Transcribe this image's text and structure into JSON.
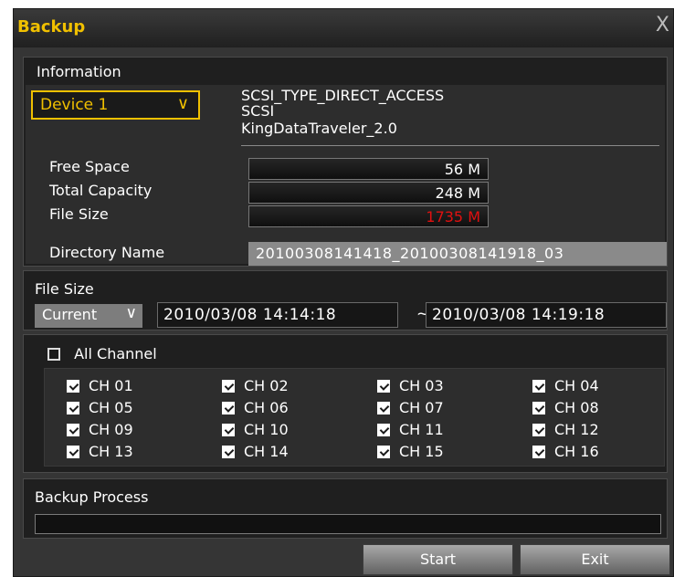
{
  "window": {
    "title": "Backup",
    "close_glyph": "X"
  },
  "information": {
    "label": "Information",
    "device": "Device 1",
    "device_lines": [
      "SCSI_TYPE_DIRECT_ACCESS",
      "SCSI",
      "KingDataTraveler_2.0"
    ],
    "rows": [
      {
        "label": "Free Space",
        "value": "56 M",
        "color": "#ffffff"
      },
      {
        "label": "Total Capacity",
        "value": "248 M",
        "color": "#ffffff"
      },
      {
        "label": "File Size",
        "value": "1735 M",
        "color": "#e01010"
      }
    ],
    "directory_label": "Directory Name",
    "directory_value": "20100308141418_20100308141918_03"
  },
  "file_size": {
    "label": "File Size",
    "mode": "Current",
    "start": "2010/03/08  14:14:18",
    "separator": "~",
    "end": "2010/03/08  14:19:18"
  },
  "channels": {
    "all_label": "All Channel",
    "all_checked": false,
    "items": [
      "CH 01",
      "CH 02",
      "CH 03",
      "CH 04",
      "CH 05",
      "CH 06",
      "CH 07",
      "CH 08",
      "CH 09",
      "CH 10",
      "CH 11",
      "CH 12",
      "CH 13",
      "CH 14",
      "CH 15",
      "CH 16"
    ],
    "checked": true
  },
  "process": {
    "label": "Backup Process",
    "progress_percent": 0
  },
  "buttons": {
    "start": "Start",
    "exit": "Exit"
  },
  "colors": {
    "accent": "#f0c000",
    "alert": "#e01010"
  }
}
